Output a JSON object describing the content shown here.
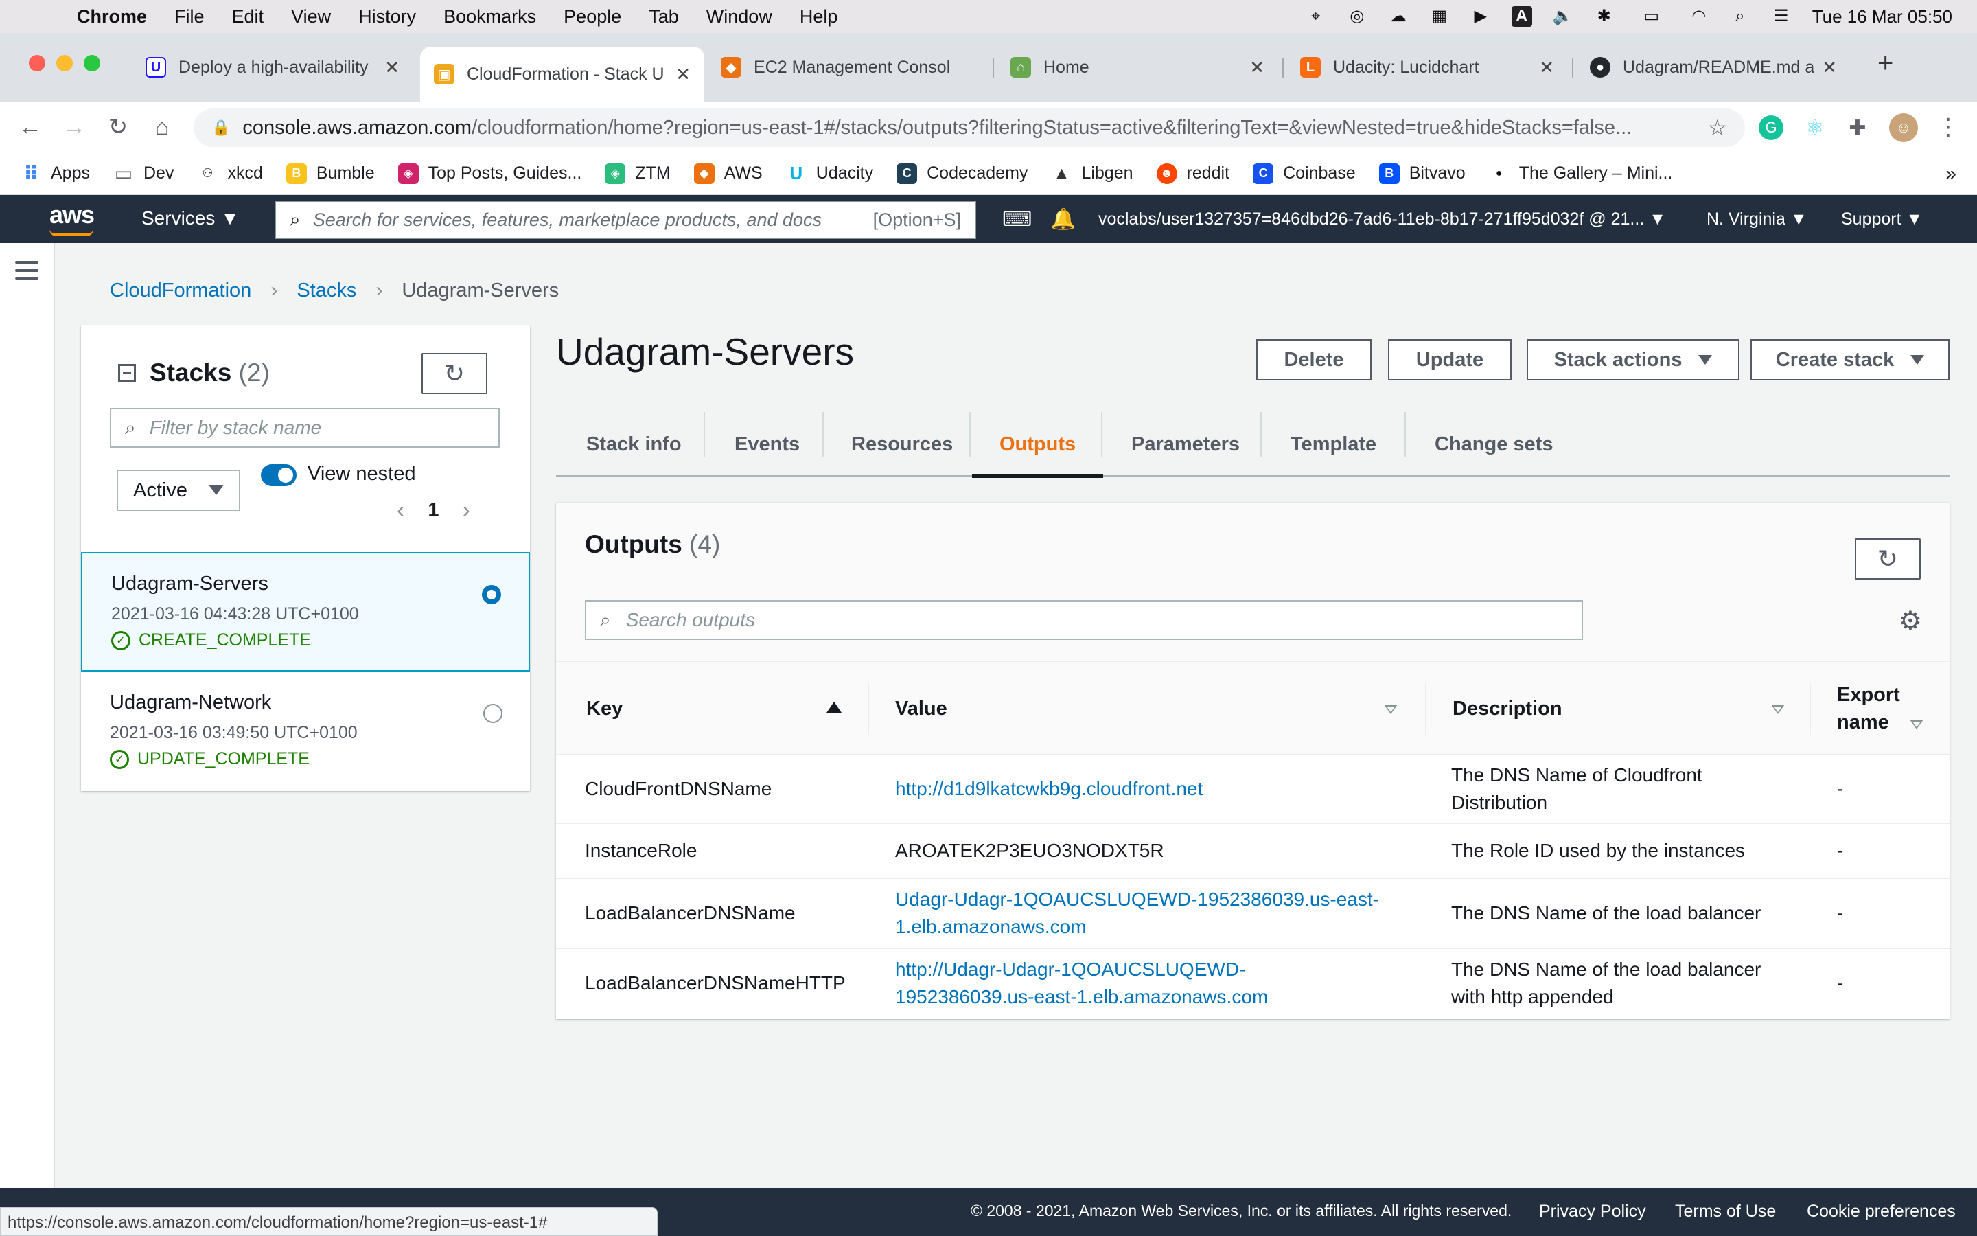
{
  "mac": {
    "menus": [
      "Chrome",
      "File",
      "Edit",
      "View",
      "History",
      "Bookmarks",
      "People",
      "Tab",
      "Window",
      "Help"
    ],
    "clock": "Tue 16 Mar  05:50"
  },
  "browser": {
    "tabs": [
      {
        "title": "Deploy a high-availability",
        "favicon": "udacity-icon",
        "color": "#2015ff"
      },
      {
        "title": "CloudFormation - Stack U",
        "favicon": "aws-icon",
        "color": "#f0a71b"
      },
      {
        "title": "EC2 Management Consol",
        "favicon": "aws-cube-icon",
        "color": "#ec7211"
      },
      {
        "title": "Home",
        "favicon": "page-icon",
        "color": "#6aa84f"
      },
      {
        "title": "Udacity: Lucidchart",
        "favicon": "lucidchart-icon",
        "color": "#f96b13"
      },
      {
        "title": "Udagram/README.md at",
        "favicon": "github-icon",
        "color": "#24292e"
      }
    ],
    "url_host": "console.aws.amazon.com",
    "url_path": "/cloudformation/home?region=us-east-1#/stacks/outputs?filteringStatus=active&filteringText=&viewNested=true&hideStacks=false...",
    "bookmarks": [
      "Apps",
      "Dev",
      "xkcd",
      "Bumble",
      "Top Posts, Guides...",
      "ZTM",
      "AWS",
      "Udacity",
      "Codecademy",
      "Libgen",
      "reddit",
      "Coinbase",
      "Bitvavo",
      "The Gallery – Mini..."
    ],
    "status_url": "https://console.aws.amazon.com/cloudformation/home?region=us-east-1#"
  },
  "aws_nav": {
    "services": "Services",
    "search_placeholder": "Search for services, features, marketplace products, and docs",
    "search_shortcut": "[Option+S]",
    "account": "voclabs/user1327357=846dbd26-7ad6-11eb-8b17-271ff95d032f @ 21...",
    "region": "N. Virginia",
    "support": "Support"
  },
  "breadcrumb": {
    "root": "CloudFormation",
    "stacks": "Stacks",
    "current": "Udagram-Servers"
  },
  "stacks_panel": {
    "title": "Stacks",
    "count": "(2)",
    "filter_placeholder": "Filter by stack name",
    "status_filter": "Active",
    "view_nested": "View nested",
    "page": "1",
    "items": [
      {
        "name": "Udagram-Servers",
        "date": "2021-03-16 04:43:28 UTC+0100",
        "status": "CREATE_COMPLETE"
      },
      {
        "name": "Udagram-Network",
        "date": "2021-03-16 03:49:50 UTC+0100",
        "status": "UPDATE_COMPLETE"
      }
    ]
  },
  "main": {
    "title": "Udagram-Servers",
    "buttons": {
      "delete": "Delete",
      "update": "Update",
      "stack_actions": "Stack actions",
      "create_stack": "Create stack"
    },
    "tabs": [
      "Stack info",
      "Events",
      "Resources",
      "Outputs",
      "Parameters",
      "Template",
      "Change sets"
    ],
    "active_tab": "Outputs"
  },
  "outputs": {
    "title": "Outputs",
    "count": "(4)",
    "search_placeholder": "Search outputs",
    "columns": {
      "key": "Key",
      "value": "Value",
      "description": "Description",
      "export_l1": "Export",
      "export_l2": "name"
    },
    "rows": [
      {
        "key": "CloudFrontDNSName",
        "value_l1": "http://d1d9lkatcwkb9g.cloudfront.net",
        "value_l2": "",
        "desc_l1": "The DNS Name of Cloudfront",
        "desc_l2": "Distribution",
        "export": "-"
      },
      {
        "key": "InstanceRole",
        "value_l1": "AROATEK2P3EUO3NODXT5R",
        "value_l2": "",
        "desc_l1": "The Role ID used by the instances",
        "desc_l2": "",
        "export": "-"
      },
      {
        "key": "LoadBalancerDNSName",
        "value_l1": "Udagr-Udagr-1QOAUCSLUQEWD-1952386039.us-east-",
        "value_l2": "1.elb.amazonaws.com",
        "desc_l1": "The DNS Name of the load balancer",
        "desc_l2": "",
        "export": "-"
      },
      {
        "key": "LoadBalancerDNSNameHTTP",
        "value_l1": "http://Udagr-Udagr-1QOAUCSLUQEWD-",
        "value_l2": "1952386039.us-east-1.elb.amazonaws.com",
        "desc_l1": "The DNS Name of the load balancer",
        "desc_l2": "with http appended",
        "export": "-"
      }
    ]
  },
  "footer": {
    "copyright": "© 2008 - 2021, Amazon Web Services, Inc. or its affiliates. All rights reserved.",
    "privacy": "Privacy Policy",
    "terms": "Terms of Use",
    "cookies": "Cookie preferences"
  },
  "colors": {
    "aws_orange": "#ec7211",
    "aws_link": "#0073bb",
    "aws_nav": "#232f3e",
    "success": "#1d8102"
  }
}
